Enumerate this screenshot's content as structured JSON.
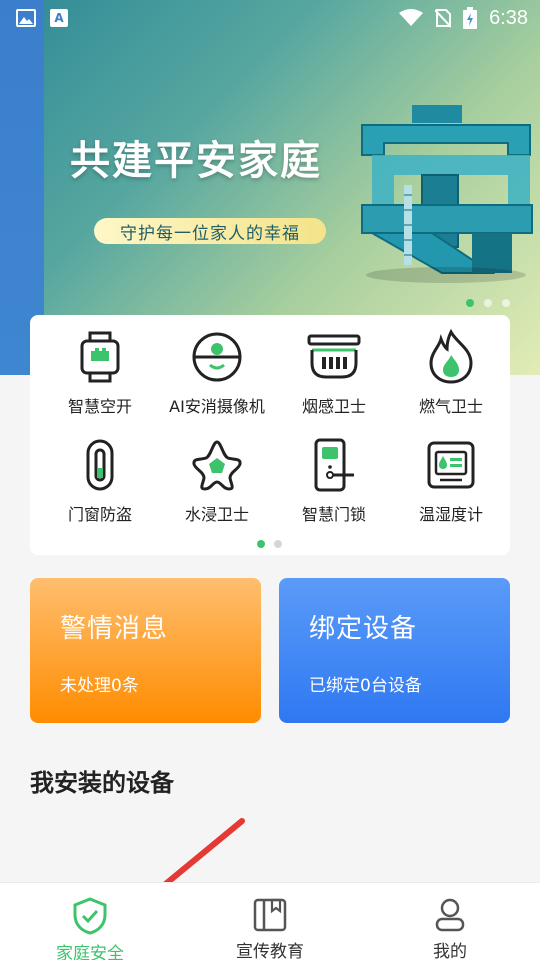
{
  "status_bar": {
    "time": "6:38",
    "icons": [
      "image-icon",
      "a-icon",
      "wifi-icon",
      "no-sim-icon",
      "battery-charging-icon"
    ]
  },
  "banner": {
    "title": "共建平安家庭",
    "subtitle": "守护每一位家人的幸福",
    "art_text": "安",
    "page_count": 3,
    "active_page": 0
  },
  "device_grid": {
    "items": [
      {
        "label": "智慧空开",
        "icon": "smart-breaker-icon"
      },
      {
        "label": "AI安消摄像机",
        "icon": "camera-icon"
      },
      {
        "label": "烟感卫士",
        "icon": "smoke-detector-icon"
      },
      {
        "label": "燃气卫士",
        "icon": "gas-flame-icon"
      },
      {
        "label": "门窗防盗",
        "icon": "door-sensor-icon"
      },
      {
        "label": "水浸卫士",
        "icon": "water-leak-icon"
      },
      {
        "label": "智慧门锁",
        "icon": "smart-lock-icon"
      },
      {
        "label": "温湿度计",
        "icon": "thermo-hygrometer-icon"
      }
    ],
    "page_count": 2,
    "active_page": 0
  },
  "cards": {
    "alert": {
      "title": "警情消息",
      "subtitle": "未处理0条"
    },
    "bind": {
      "title": "绑定设备",
      "subtitle": "已绑定0台设备"
    }
  },
  "section": {
    "title": "我安装的设备"
  },
  "bottom_nav": {
    "items": [
      {
        "label": "家庭安全",
        "icon": "shield-check-icon",
        "active": true
      },
      {
        "label": "宣传教育",
        "icon": "book-icon",
        "active": false
      },
      {
        "label": "我的",
        "icon": "user-icon",
        "active": false
      }
    ]
  },
  "colors": {
    "accent_green": "#3cc36c",
    "alert_orange": "#ff8c00",
    "bind_blue": "#2f78f2"
  }
}
